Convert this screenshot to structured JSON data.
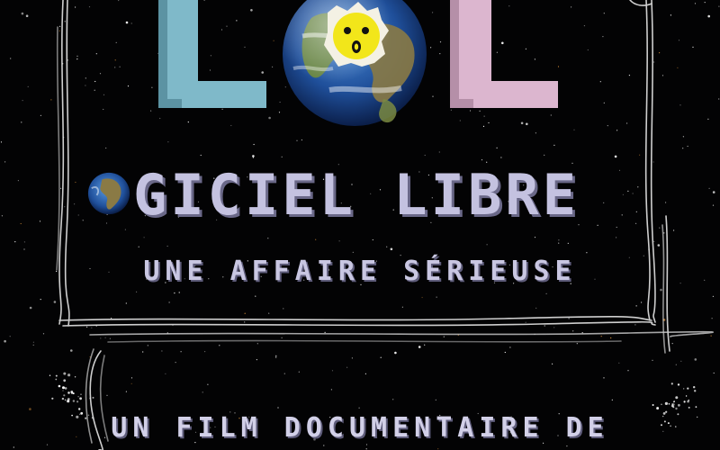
{
  "poster": {
    "logo": {
      "letter_left": "L",
      "letter_middle": "O",
      "letter_right": "L",
      "color_left": "#7fb9c9",
      "color_right": "#dcb6cf"
    },
    "title": {
      "first_letter": "L",
      "globe_letter": "O",
      "rest": "GICIEL LIBRE"
    },
    "subtitle": "UNE AFFAIRE SÉRIEUSE",
    "credit": "UN FILM DOCUMENTAIRE DE",
    "colors": {
      "text": "#c4c2e0",
      "text_shadow": "#6a6888",
      "background": "#030304",
      "chalk": "#e8e8e8",
      "smiley": "#f2e61a"
    }
  }
}
